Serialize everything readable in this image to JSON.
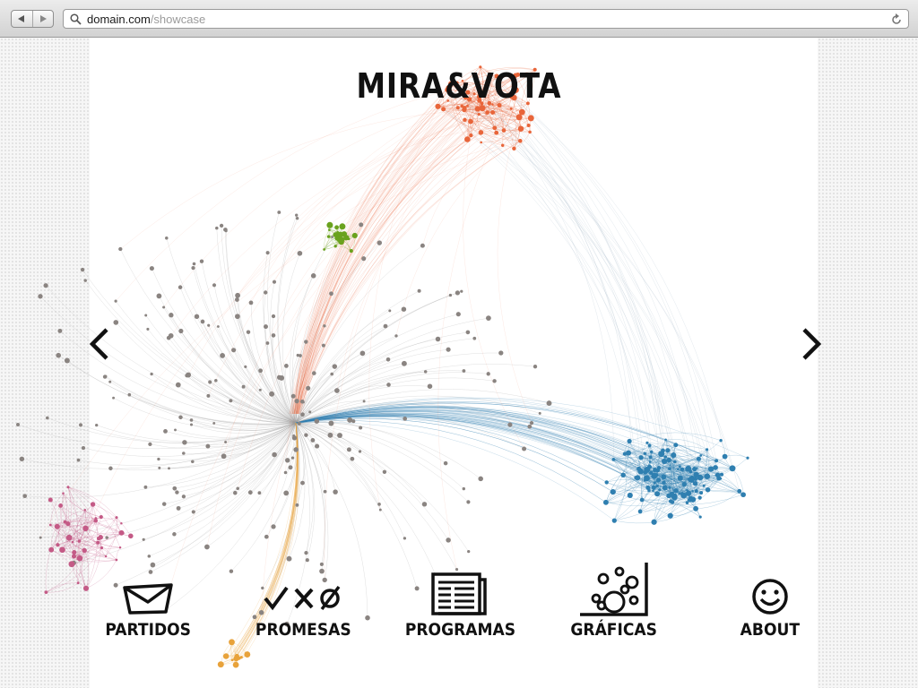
{
  "browser": {
    "domain": "domain.com",
    "path": "/showcase"
  },
  "page": {
    "title": "MIRA&VOTA"
  },
  "nav": [
    {
      "label": "PARTIDOS",
      "icon": "envelope-icon"
    },
    {
      "label": "PROMESAS",
      "icon": "check-cross-null-icon"
    },
    {
      "label": "PROGRAMAS",
      "icon": "documents-icon"
    },
    {
      "label": "GRÁFICAS",
      "icon": "bubble-chart-icon"
    },
    {
      "label": "ABOUT",
      "icon": "smiley-icon"
    }
  ],
  "colors": {
    "orange_cluster": "#e8653a",
    "blue_cluster": "#2f7fb0",
    "green_cluster": "#6aa21e",
    "pink_cluster": "#c45a86",
    "grey_nodes": "#8a8481",
    "gold_cluster": "#e8a23a"
  }
}
